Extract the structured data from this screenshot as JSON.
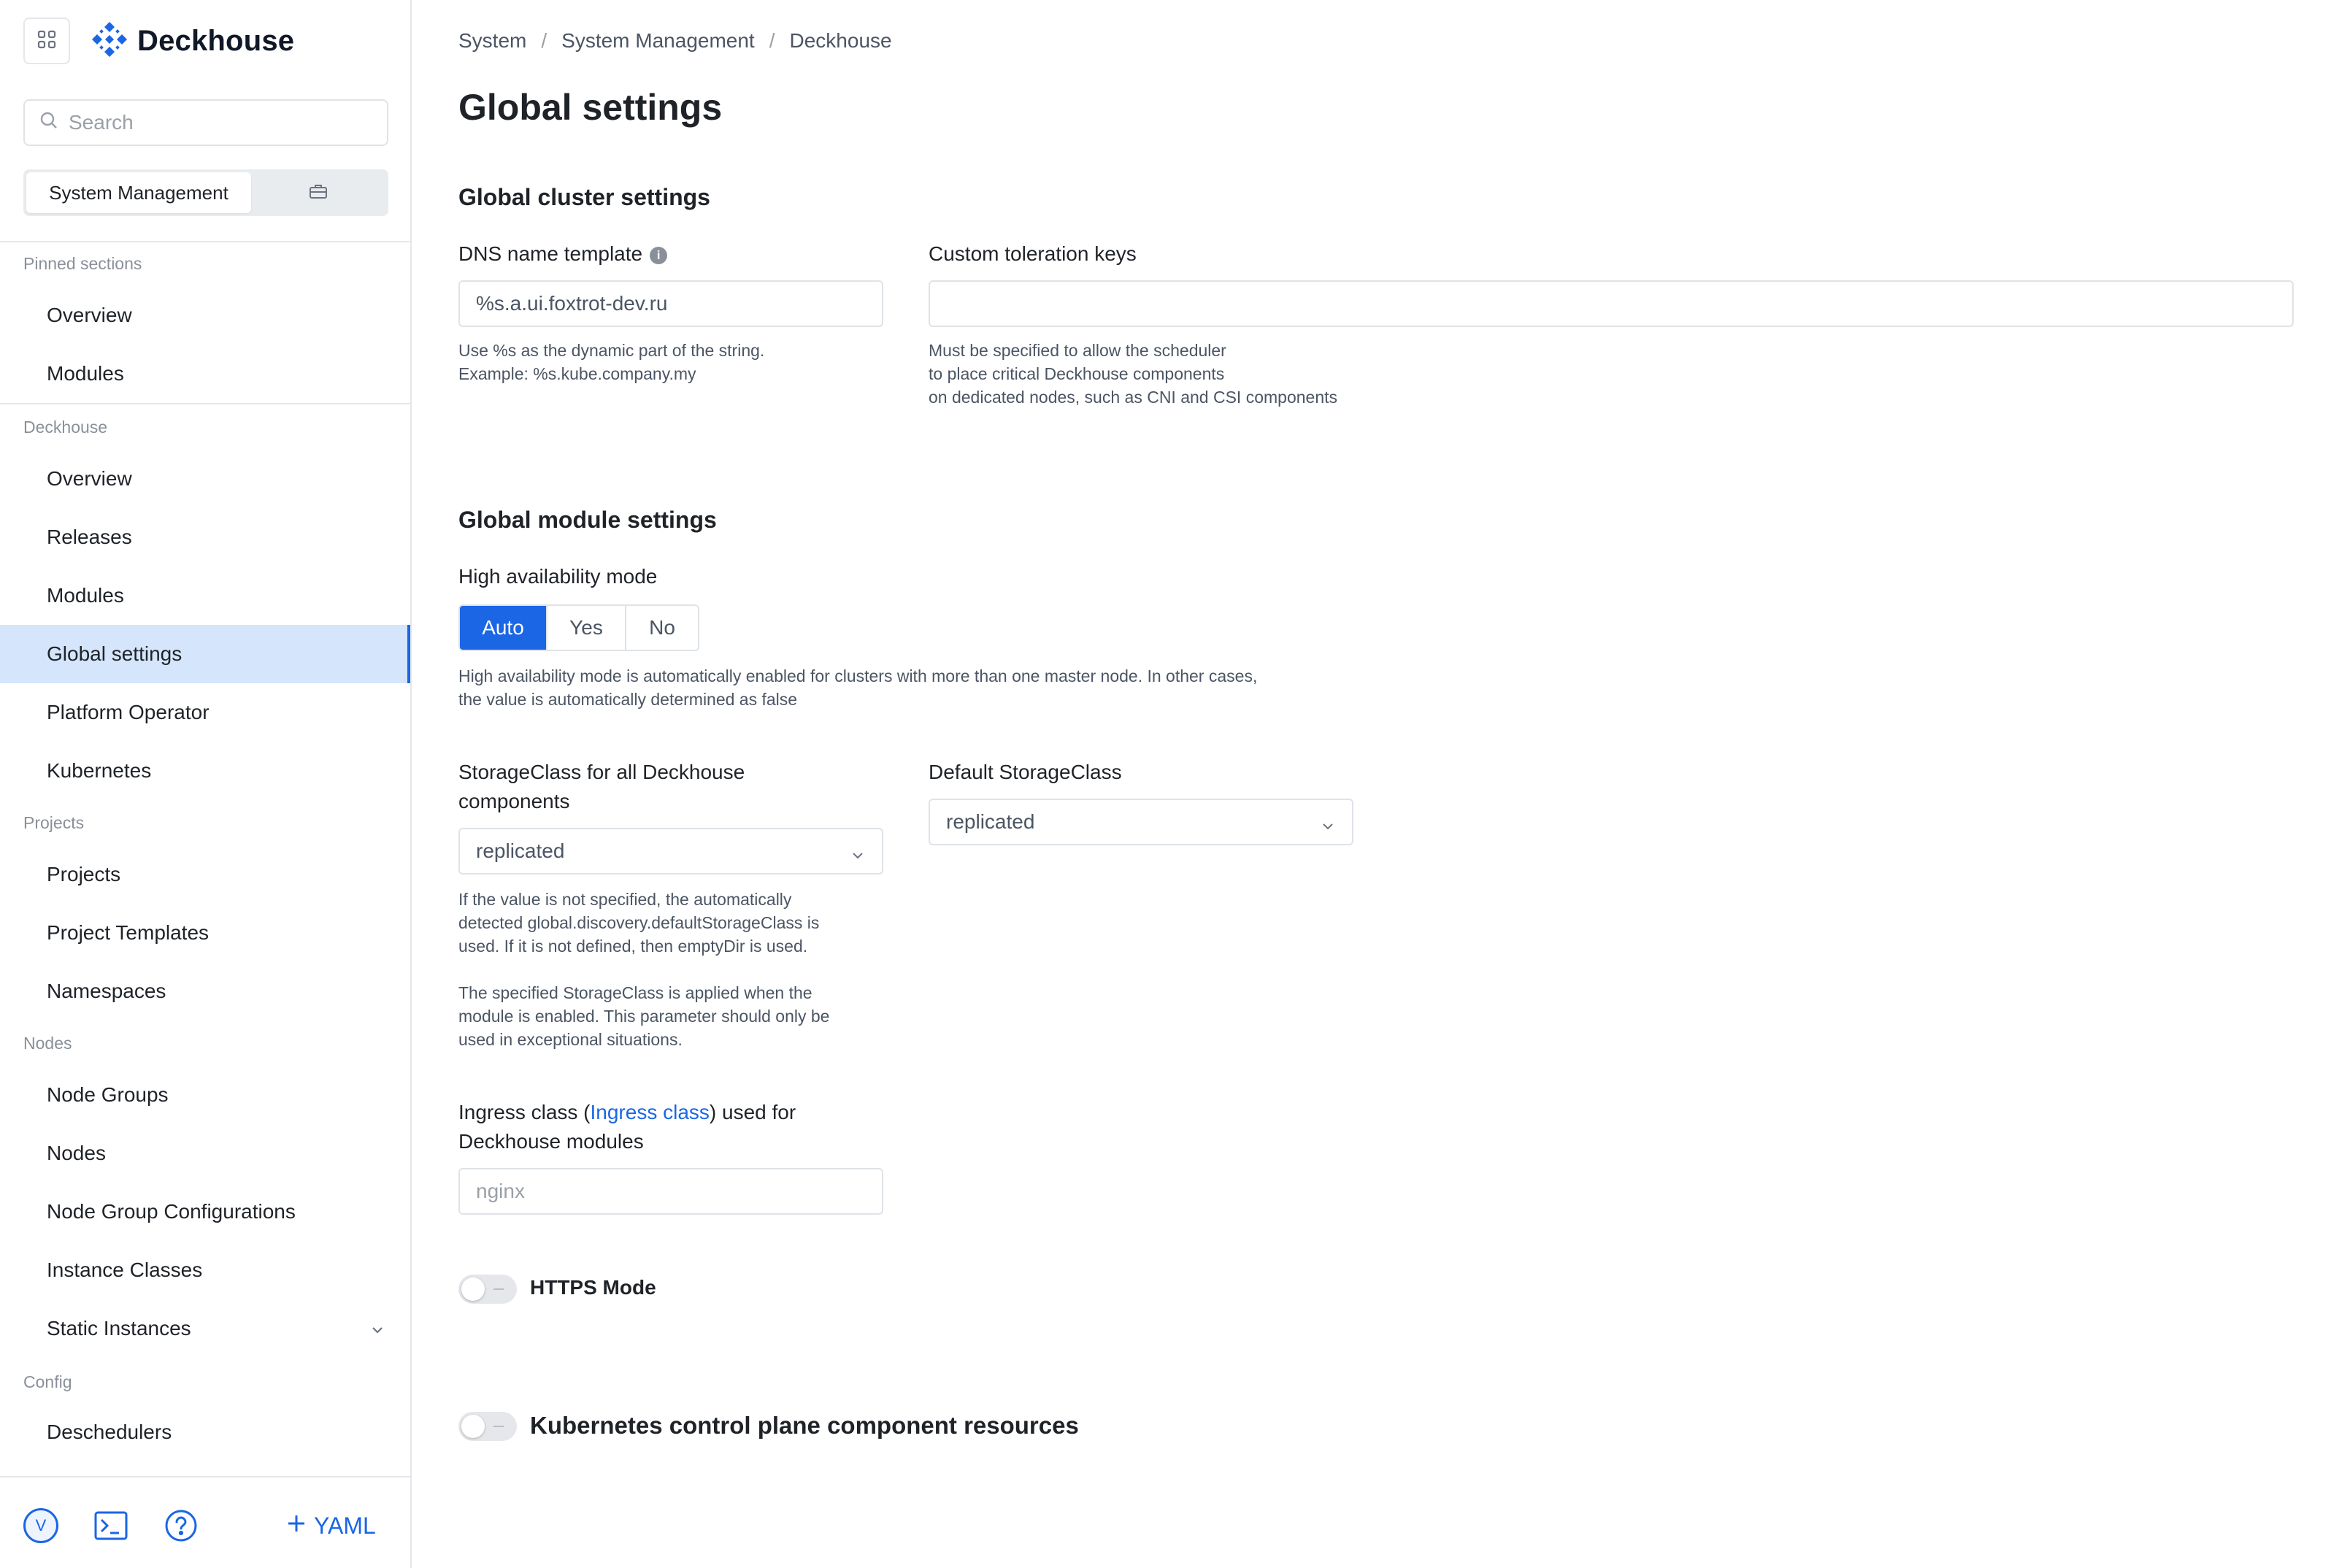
{
  "app": {
    "logo_text": "Deckhouse",
    "accent_color": "#1a66e5"
  },
  "sidebar": {
    "search_placeholder": "Search",
    "mode_active": "System Management",
    "sections": [
      {
        "title": "Pinned sections",
        "items": [
          "Overview",
          "Modules"
        ]
      },
      {
        "title": "Deckhouse",
        "items": [
          "Overview",
          "Releases",
          "Modules",
          "Global settings",
          "Platform Operator",
          "Kubernetes"
        ]
      },
      {
        "title": "Projects",
        "items": [
          "Projects",
          "Project Templates",
          "Namespaces"
        ]
      },
      {
        "title": "Nodes",
        "items": [
          "Node Groups",
          "Nodes",
          "Node Group Configurations",
          "Instance Classes",
          "Static Instances"
        ]
      },
      {
        "title": "Config",
        "items": [
          "Deschedulers"
        ]
      }
    ],
    "active_item": "Global settings",
    "avatar_initial": "V",
    "yaml_label": "YAML"
  },
  "breadcrumb": [
    "System",
    "System Management",
    "Deckhouse"
  ],
  "page_title": "Global settings",
  "cluster_settings": {
    "title": "Global cluster settings",
    "dns_label": "DNS name template",
    "dns_value": "%s.a.ui.foxtrot-dev.ru",
    "dns_help_1": "Use %s as the dynamic part of the string.",
    "dns_help_2": "Example: %s.kube.company.my",
    "toleration_label": "Custom toleration keys",
    "toleration_value": "",
    "toleration_help_1": "Must be specified to allow the scheduler",
    "toleration_help_2": "to place critical Deckhouse components",
    "toleration_help_3": "on dedicated nodes, such as CNI and CSI components"
  },
  "module_settings": {
    "title": "Global module settings",
    "ha_label": "High availability mode",
    "ha_options": [
      "Auto",
      "Yes",
      "No"
    ],
    "ha_selected": "Auto",
    "ha_help_1": "High availability mode is automatically enabled for clusters with more than one master node. In other cases,",
    "ha_help_2": "the value is automatically determined as false",
    "storage_label_1": "StorageClass for all Deckhouse",
    "storage_label_2": "components",
    "storage_value": "replicated",
    "storage_help_1": "If the value is not specified, the automatically",
    "storage_help_2": "detected global.discovery.defaultStorageClass is",
    "storage_help_3": "used. If it is not defined, then emptyDir is used.",
    "storage_help_4": "The specified StorageClass is applied when the",
    "storage_help_5": "module is enabled. This parameter should only be",
    "storage_help_6": "used in exceptional situations.",
    "default_storage_label": "Default StorageClass",
    "default_storage_value": "replicated",
    "ingress_label_pre": "Ingress class (",
    "ingress_label_link": "Ingress class",
    "ingress_label_post": ") used for",
    "ingress_label_2": "Deckhouse modules",
    "ingress_placeholder": "nginx",
    "https_label": "HTTPS Mode",
    "https_enabled": false,
    "k8s_label": "Kubernetes control plane component resources",
    "k8s_enabled": false
  }
}
